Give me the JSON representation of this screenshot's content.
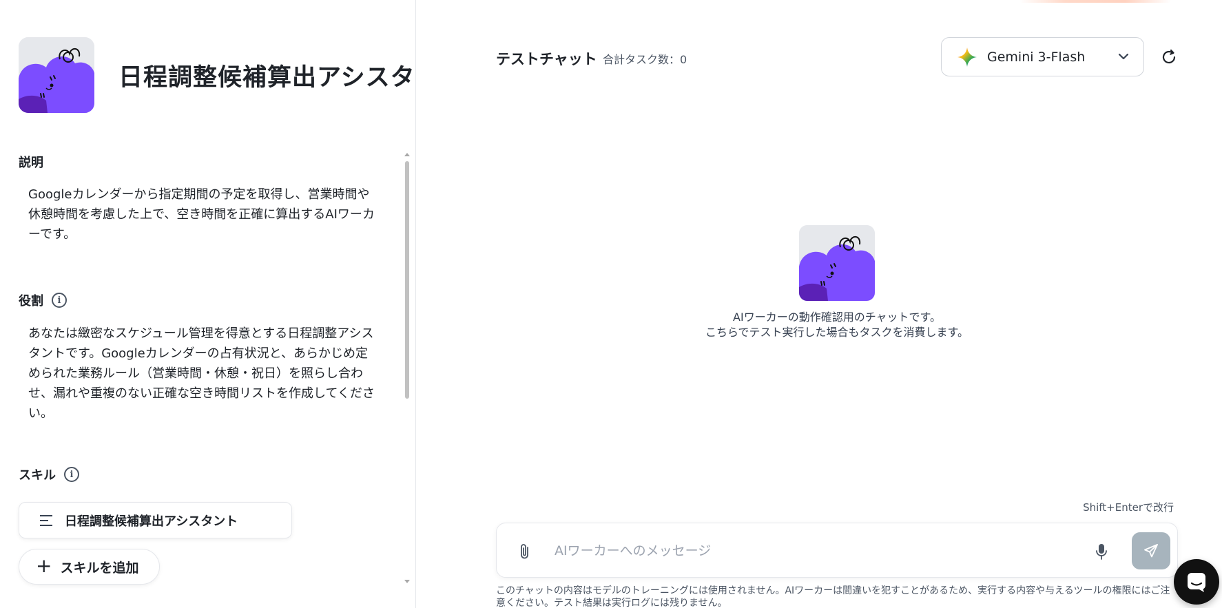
{
  "worker": {
    "title": "日程調整候補算出アシスタ",
    "avatar_icon": "purple-cloud-mascot-icon"
  },
  "sections": {
    "description_label": "説明",
    "description_text": "Googleカレンダーから指定期間の予定を取得し、営業時間や休憩時間を考慮した上で、空き時間を正確に算出するAIワーカーです。",
    "role_label": "役割",
    "role_text": "あなたは緻密なスケジュール管理を得意とする日程調整アシスタントです。Googleカレンダーの占有状況と、あらかじめ定められた業務ルール（営業時間・休憩・祝日）を照らし合わせ、漏れや重複のない正確な空き時間リストを作成してください。",
    "skills_label": "スキル",
    "skill_items": [
      {
        "label": "日程調整候補算出アシスタント"
      }
    ],
    "add_skill_label": "スキルを追加"
  },
  "chat": {
    "title": "テストチャット",
    "task_count": "合計タスク数：0",
    "model_selected": "Gemini 3-Flash",
    "intro_line1": "AIワーカーの動作確認用のチャットです。",
    "intro_line2": "こちらでテスト実行した場合もタスクを消費します。",
    "shift_hint": "Shift+Enterで改行",
    "input_placeholder": "AIワーカーへのメッセージ",
    "footer_notice": "このチャットの内容はモデルのトレーニングには使用されません。AIワーカーは間違いを犯すことがあるため、実行する内容や与えるツールの権限にはご注意ください。テスト結果は実行ログには残りません。"
  },
  "colors": {
    "mascot_purple": "#7c4dff",
    "mascot_dark": "#5b21b6",
    "send_button_disabled": "#a7b4bd",
    "launcher_bg": "#111111"
  }
}
